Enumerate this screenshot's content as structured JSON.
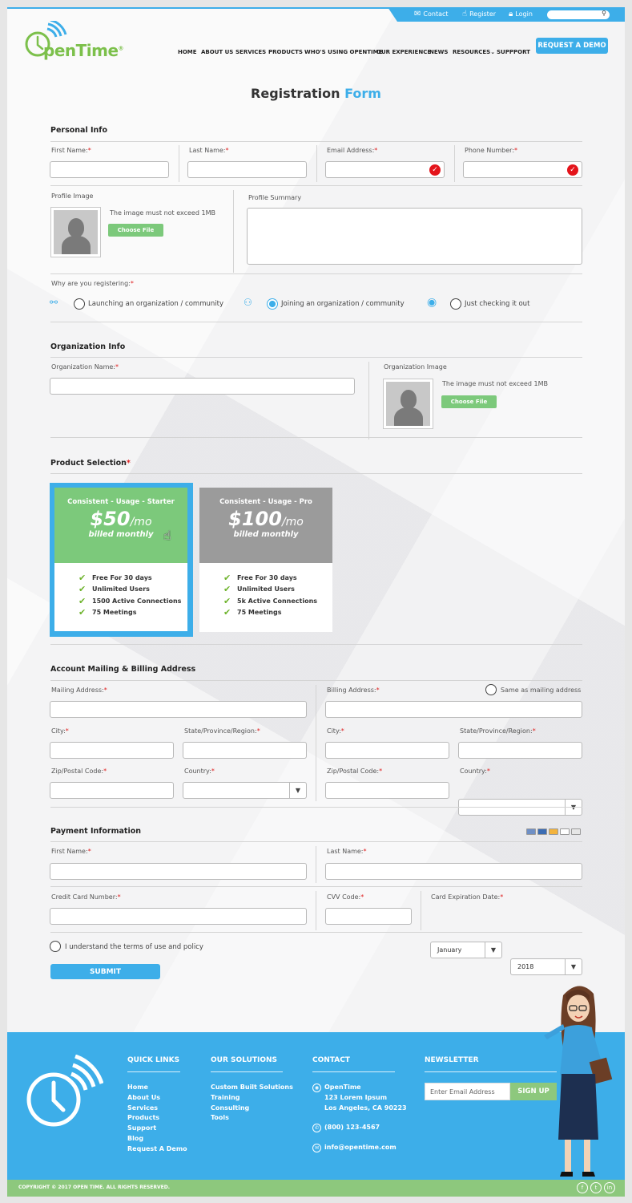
{
  "topbar": {
    "contact": "Contact",
    "register": "Register",
    "login": "Login"
  },
  "brand": {
    "name": "penTime",
    "reg": "®"
  },
  "nav": {
    "items": [
      "HOME",
      "ABOUT US",
      "SERVICES",
      "PRODUCTS",
      "WHO'S USING OPENTIME",
      "OUR EXPERIENCE",
      "NEWS",
      "RESOURCES",
      "SUPPPORT"
    ],
    "cta": "REQUEST A DEMO"
  },
  "title": {
    "main": "Registration",
    "accent": "Form"
  },
  "personal": {
    "heading": "Personal Info",
    "first_name": "First Name:",
    "last_name": "Last Name:",
    "email": "Email Address:",
    "phone": "Phone Number:",
    "profile_image": "Profile Image",
    "image_note": "The image must not exceed 1MB",
    "choose_file": "Choose File",
    "profile_summary": "Profile Summary"
  },
  "reason": {
    "heading": "Why are you registering:",
    "options": [
      "Launching an organization / community",
      "Joining an organization / community",
      "Just checking it out"
    ],
    "selected": 1
  },
  "organization": {
    "heading": "Organization Info",
    "name": "Organization Name:",
    "image": "Organization Image",
    "image_note": "The image must not exceed 1MB",
    "choose_file": "Choose File"
  },
  "products": {
    "heading": "Product Selection",
    "plans": [
      {
        "name": "Consistent - Usage - Starter",
        "price": "$50",
        "unit": "/mo",
        "billed": "billed monthly",
        "color": "#7cc97b",
        "features": [
          "Free For 30 days",
          "Unlimited Users",
          "1500 Active Connections",
          "75 Meetings"
        ]
      },
      {
        "name": "Consistent - Usage - Pro",
        "price": "$100",
        "unit": "/mo",
        "billed": "billed monthly",
        "color": "#9b9b9b",
        "features": [
          "Free For 30 days",
          "Unlimited Users",
          "5k Active Connections",
          "75 Meetings"
        ]
      }
    ],
    "selected": 0
  },
  "address": {
    "heading": "Account Mailing & Billing Address",
    "mailing": "Mailing Address:",
    "billing": "Billing Address:",
    "same": "Same as mailing address",
    "city": "City:",
    "state": "State/Province/Region:",
    "zip": "Zip/Postal Code:",
    "country": "Country:"
  },
  "payment": {
    "heading": "Payment Information",
    "first_name": "First Name:",
    "last_name": "Last Name:",
    "card_number": "Credit Card Number:",
    "cvv": "CVV Code:",
    "expiration": "Card Expiration Date:",
    "month": "January",
    "year": "2018"
  },
  "terms": "I understand the terms of use and policy",
  "submit": "SUBMIT",
  "footer": {
    "quick_links_title": "QUICK LINKS",
    "quick_links": [
      "Home",
      "About Us",
      "Services",
      "Products",
      "Support",
      "Blog",
      "Request A Demo"
    ],
    "solutions_title": "OUR SOLUTIONS",
    "solutions": [
      "Custom Built Solutions",
      "Training",
      "Consulting",
      "Tools"
    ],
    "contact_title": "CONTACT",
    "company": "OpenTime",
    "street": "123 Lorem Ipsum",
    "city": "Los Angeles, CA 90223",
    "phone": "(800) 123-4567",
    "email": "info@opentime.com",
    "newsletter_title": "NEWSLETTER",
    "newsletter_placeholder": "Enter Email Address",
    "signup": "SIGN UP",
    "copyright": "COPYRIGHT © 2017 OPEN TIME. ALL RIGHTS RESERVED.",
    "social": [
      "f",
      "t",
      "in"
    ]
  },
  "colors": {
    "accent": "#3daee9",
    "green": "#7cc97b",
    "required": "#e02020"
  }
}
